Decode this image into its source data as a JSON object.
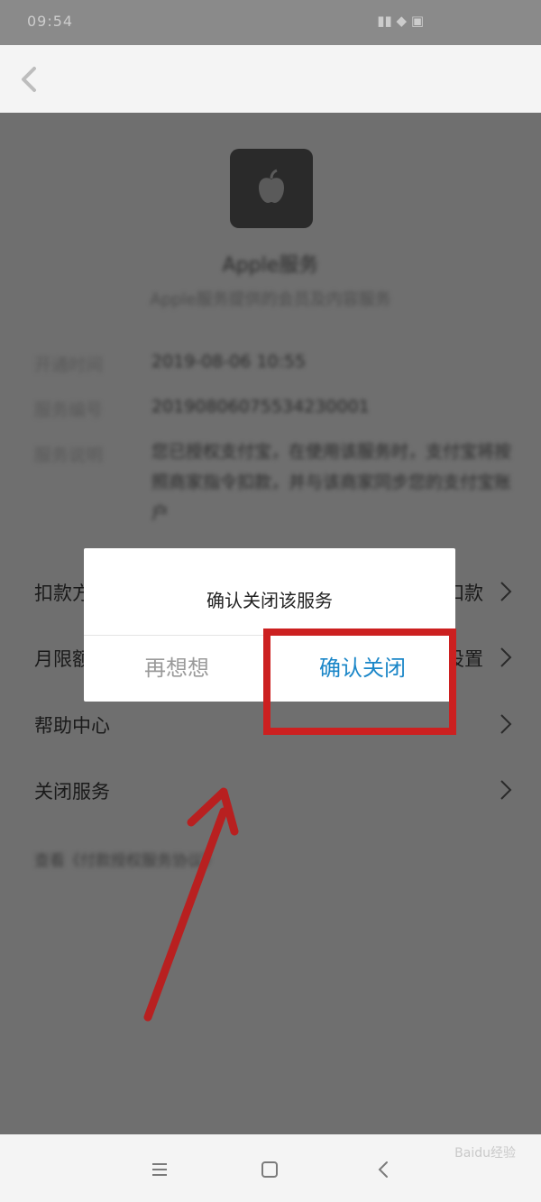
{
  "status_bar": {
    "time": "09:54",
    "icons": "▮▮ ◆ ▣"
  },
  "dialog": {
    "title": "确认关闭该服务",
    "cancel_label": "再想想",
    "confirm_label": "确认关闭"
  },
  "service": {
    "name": "Apple服务",
    "subtitle": "Apple服务提供的会员及内容服务"
  },
  "details": [
    {
      "label": "开通时间",
      "value": "2019-08-06 10:55"
    },
    {
      "label": "服务编号",
      "value": "20190806075534230001"
    },
    {
      "label": "服务说明",
      "value": "您已授权支付宝，在使用该服务时，支付宝将按照商家指令扣款，并与该商家同步您的支付宝账户"
    }
  ],
  "menu": {
    "items": [
      {
        "label": "扣款方式",
        "value": "自动扣款"
      },
      {
        "label": "月限额",
        "value": "设置"
      },
      {
        "label": "帮助中心",
        "value": ""
      },
      {
        "label": "关闭服务",
        "value": ""
      }
    ]
  },
  "agreement": "查看《付款授权服务协议》",
  "watermark": "Baidu经验",
  "colors": {
    "accent": "#1a86c8",
    "highlight": "#cc2020",
    "overlay": "#6f6f6f"
  }
}
